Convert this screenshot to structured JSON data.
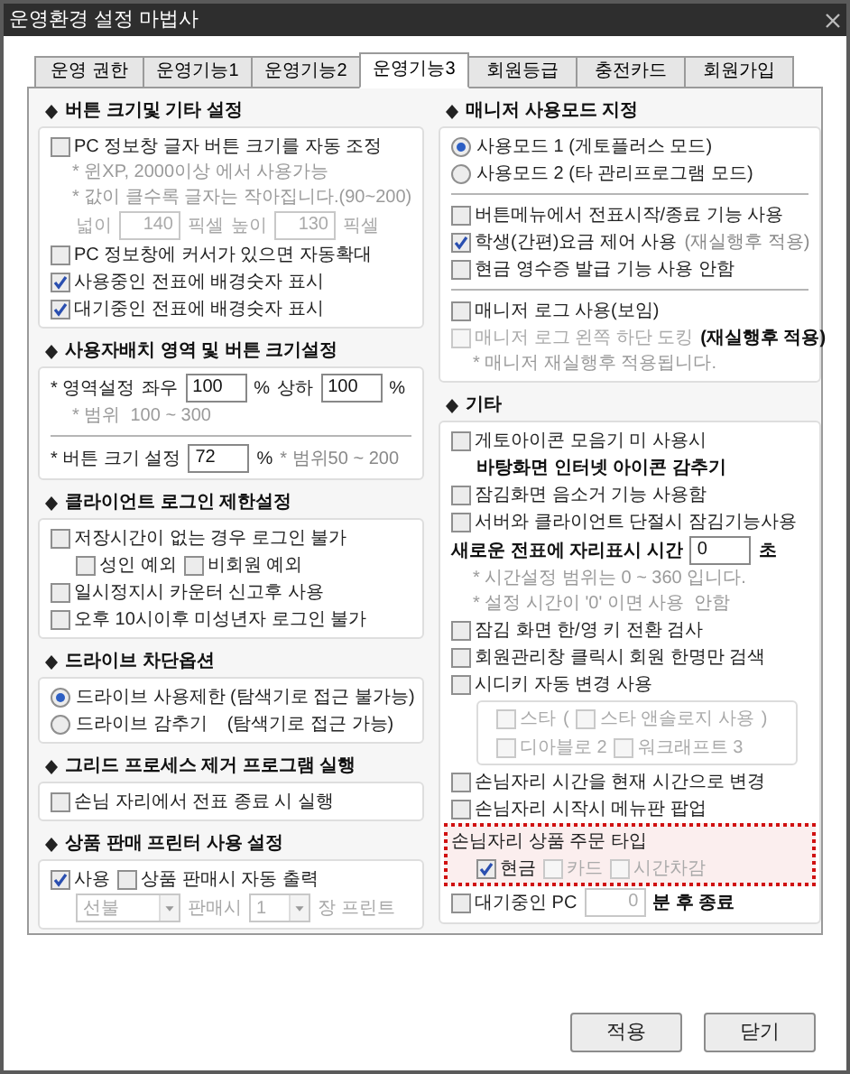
{
  "window": {
    "title": "운영환경 설정 마법사"
  },
  "tabs": [
    {
      "label": "운영 권한",
      "selected": false
    },
    {
      "label": "운영기능1",
      "selected": false
    },
    {
      "label": "운영기능2",
      "selected": false
    },
    {
      "label": "운영기능3",
      "selected": true
    },
    {
      "label": "회원등급",
      "selected": false
    },
    {
      "label": "충전카드",
      "selected": false
    },
    {
      "label": "회원가입",
      "selected": false
    }
  ],
  "left": [
    {
      "title": "버튼 크기및 기타 설정",
      "rows": [
        {
          "kind": "line",
          "parts": [
            {
              "kind": "checkbox",
              "label": "PC 정보창 글자 버튼 크기를 자동 조정",
              "checked": false,
              "disabled": false
            }
          ]
        },
        {
          "kind": "note",
          "text": "* 윈XP, 2000이상 에서 사용가능"
        },
        {
          "kind": "note",
          "text": "* 값이 클수록 글자는 작아집니다.(90~200)"
        },
        {
          "kind": "subline",
          "parts": [
            {
              "kind": "muted-text",
              "text": "넓이"
            },
            {
              "kind": "input",
              "value": "140",
              "disabled": true
            },
            {
              "kind": "muted-text",
              "text": "픽셀"
            },
            {
              "kind": "muted-text",
              "text": "높이"
            },
            {
              "kind": "input",
              "value": "130",
              "disabled": true
            },
            {
              "kind": "muted-text",
              "text": "픽셀"
            }
          ]
        },
        {
          "kind": "line",
          "parts": [
            {
              "kind": "checkbox",
              "label": "PC 정보창에 커서가 있으면 자동확대",
              "checked": false,
              "disabled": false
            }
          ]
        },
        {
          "kind": "line",
          "parts": [
            {
              "kind": "checkbox",
              "label": "사용중인 전표에 배경숫자 표시",
              "checked": true,
              "disabled": false
            }
          ]
        },
        {
          "kind": "line",
          "parts": [
            {
              "kind": "checkbox",
              "label": "대기중인 전표에 배경숫자 표시",
              "checked": true,
              "disabled": false
            }
          ]
        }
      ]
    },
    {
      "title": "사용자배치 영역 및 버튼 크기설정",
      "rows": [
        {
          "kind": "line",
          "parts": [
            {
              "kind": "text",
              "text": "* 영역설정"
            },
            {
              "kind": "text",
              "text": "좌우"
            },
            {
              "kind": "input",
              "value": "100",
              "disabled": false
            },
            {
              "kind": "text",
              "text": "%"
            },
            {
              "kind": "text",
              "text": "상하"
            },
            {
              "kind": "input",
              "value": "100",
              "disabled": false
            },
            {
              "kind": "text",
              "text": "%"
            }
          ]
        },
        {
          "kind": "note",
          "text": "* 범위  100 ~ 300"
        },
        {
          "kind": "divider"
        },
        {
          "kind": "line",
          "parts": [
            {
              "kind": "text",
              "text": "* 버튼 크기  설정"
            },
            {
              "kind": "input",
              "value": "72",
              "disabled": false
            },
            {
              "kind": "text",
              "text": "%"
            },
            {
              "kind": "hint-text",
              "text": "* 범위50 ~ 200"
            }
          ]
        }
      ]
    },
    {
      "title": "클라이언트 로그인 제한설정",
      "rows": [
        {
          "kind": "line",
          "parts": [
            {
              "kind": "checkbox",
              "label": "저장시간이 없는 경우 로그인 불가",
              "checked": false,
              "disabled": false
            }
          ]
        },
        {
          "kind": "subline",
          "parts": [
            {
              "kind": "checkbox",
              "label": "성인 예외",
              "checked": false,
              "disabled": false
            },
            {
              "kind": "checkbox",
              "label": "비회원 예외",
              "checked": false,
              "disabled": false
            }
          ]
        },
        {
          "kind": "line",
          "parts": [
            {
              "kind": "checkbox",
              "label": "일시정지시 카운터 신고후 사용",
              "checked": false,
              "disabled": false
            }
          ]
        },
        {
          "kind": "line",
          "parts": [
            {
              "kind": "checkbox",
              "label": "오후 10시이후 미성년자 로그인 불가",
              "checked": false,
              "disabled": false
            }
          ]
        }
      ]
    },
    {
      "title": "드라이브 차단옵션",
      "rows": [
        {
          "kind": "line",
          "parts": [
            {
              "kind": "radio",
              "label": "드라이브 사용제한 (탐색기로 접근 불가능)",
              "selected": true
            }
          ]
        },
        {
          "kind": "line",
          "parts": [
            {
              "kind": "radio",
              "label": "드라이브 감추기    (탐색기로 접근 가능)",
              "selected": false
            }
          ]
        }
      ]
    },
    {
      "title": "그리드 프로세스 제거 프로그램 실행",
      "rows": [
        {
          "kind": "line",
          "parts": [
            {
              "kind": "checkbox",
              "label": "손님 자리에서 전표 종료 시 실행",
              "checked": false,
              "disabled": false
            }
          ]
        }
      ]
    },
    {
      "title": "상품 판매 프린터 사용 설정",
      "rows": [
        {
          "kind": "line",
          "parts": [
            {
              "kind": "checkbox",
              "label": "사용",
              "checked": true,
              "disabled": false
            },
            {
              "kind": "checkbox",
              "label": "상품 판매시 자동 출력",
              "checked": false,
              "disabled": false
            }
          ]
        },
        {
          "kind": "subline",
          "parts": [
            {
              "kind": "select",
              "value": "선불",
              "disabled": true
            },
            {
              "kind": "muted-text",
              "text": "판매시"
            },
            {
              "kind": "select",
              "value": "1",
              "disabled": true
            },
            {
              "kind": "muted-text",
              "text": "장 프린트"
            }
          ]
        }
      ]
    }
  ],
  "right": [
    {
      "title": "매니저 사용모드 지정",
      "rows": [
        {
          "kind": "line",
          "parts": [
            {
              "kind": "radio",
              "label": "사용모드 1 (게토플러스 모드)",
              "selected": true
            }
          ]
        },
        {
          "kind": "line",
          "parts": [
            {
              "kind": "radio",
              "label": "사용모드 2 (타 관리프로그램 모드)",
              "selected": false
            }
          ]
        },
        {
          "kind": "divider"
        },
        {
          "kind": "line",
          "parts": [
            {
              "kind": "checkbox",
              "label": "버튼메뉴에서 전표시작/종료 기능 사용",
              "checked": false,
              "disabled": false
            }
          ]
        },
        {
          "kind": "line",
          "parts": [
            {
              "kind": "checkbox",
              "label": "학생(간편)요금 제어 사용",
              "checked": true,
              "disabled": false
            },
            {
              "kind": "hint-text",
              "text": "(재실행후 적용)"
            }
          ]
        },
        {
          "kind": "line",
          "parts": [
            {
              "kind": "checkbox",
              "label": "현금 영수증 발급 기능 사용 안함",
              "checked": false,
              "disabled": false
            }
          ]
        },
        {
          "kind": "divider"
        },
        {
          "kind": "line",
          "parts": [
            {
              "kind": "checkbox",
              "label": "매니저 로그 사용(보임)",
              "checked": false,
              "disabled": false
            }
          ]
        },
        {
          "kind": "line",
          "parts": [
            {
              "kind": "checkbox",
              "label": "매니저 로그 왼쪽 하단 도킹",
              "checked": false,
              "disabled": true
            },
            {
              "kind": "bold-text",
              "text": "(재실행후 적용)"
            }
          ]
        },
        {
          "kind": "note",
          "text": "* 매니저 재실행후 적용됩니다."
        }
      ]
    },
    {
      "title": "기타",
      "rows": [
        {
          "kind": "line",
          "parts": [
            {
              "kind": "checkbox",
              "label": "게토아이콘 모음기 미 사용시",
              "checked": false,
              "disabled": false
            }
          ]
        },
        {
          "kind": "subline",
          "parts": [
            {
              "kind": "bold-text",
              "text": "바탕화면 인터넷 아이콘 감추기"
            }
          ]
        },
        {
          "kind": "line",
          "parts": [
            {
              "kind": "checkbox",
              "label": "잠김화면 음소거 기능 사용함",
              "checked": false,
              "disabled": false
            }
          ]
        },
        {
          "kind": "line",
          "parts": [
            {
              "kind": "checkbox",
              "label": "서버와 클라이언트 단절시 잠김기능사용",
              "checked": false,
              "disabled": false
            }
          ]
        },
        {
          "kind": "line",
          "parts": [
            {
              "kind": "bold-text",
              "text": "새로운 전표에 자리표시 시간"
            },
            {
              "kind": "input",
              "value": "0",
              "disabled": false
            },
            {
              "kind": "bold-text",
              "text": "초"
            }
          ]
        },
        {
          "kind": "note",
          "text": "* 시간설정 범위는 0 ~ 360 입니다."
        },
        {
          "kind": "note",
          "text": "* 설정 시간이 '0' 이면 사용  안함"
        },
        {
          "kind": "line",
          "parts": [
            {
              "kind": "checkbox",
              "label": "잠김 화면 한/영 키 전환 검사",
              "checked": false,
              "disabled": false
            }
          ]
        },
        {
          "kind": "line",
          "parts": [
            {
              "kind": "checkbox",
              "label": "회원관리창 클릭시 회원 한명만 검색",
              "checked": false,
              "disabled": false
            }
          ]
        },
        {
          "kind": "line",
          "parts": [
            {
              "kind": "checkbox",
              "label": "시디키 자동 변경 사용",
              "checked": false,
              "disabled": false
            }
          ]
        },
        {
          "kind": "group",
          "rows": [
            {
              "kind": "line",
              "parts": [
                {
                  "kind": "checkbox",
                  "label": "스타",
                  "checked": false,
                  "disabled": true
                },
                {
                  "kind": "muted-text",
                  "text": "("
                },
                {
                  "kind": "checkbox",
                  "label": "스타 앤솔로지 사용",
                  "checked": false,
                  "disabled": true
                },
                {
                  "kind": "muted-text",
                  "text": ")"
                }
              ]
            },
            {
              "kind": "line",
              "parts": [
                {
                  "kind": "checkbox",
                  "label": "디아블로 2",
                  "checked": false,
                  "disabled": true
                },
                {
                  "kind": "checkbox",
                  "label": "워크래프트 3",
                  "checked": false,
                  "disabled": true
                }
              ]
            }
          ]
        },
        {
          "kind": "line",
          "parts": [
            {
              "kind": "checkbox",
              "label": "손님자리 시간을 현재 시간으로 변경",
              "checked": false,
              "disabled": false
            }
          ]
        },
        {
          "kind": "line",
          "parts": [
            {
              "kind": "checkbox",
              "label": "손님자리 시작시 메뉴판 팝업",
              "checked": false,
              "disabled": false
            }
          ]
        },
        {
          "kind": "highlight",
          "rows": [
            {
              "kind": "line",
              "parts": [
                {
                  "kind": "text",
                  "text": "손님자리 상품 주문 타입"
                }
              ]
            },
            {
              "kind": "subline",
              "parts": [
                {
                  "kind": "checkbox",
                  "label": "현금",
                  "checked": true,
                  "disabled": false
                },
                {
                  "kind": "checkbox",
                  "label": "카드",
                  "checked": false,
                  "disabled": true
                },
                {
                  "kind": "checkbox",
                  "label": "시간차감",
                  "checked": false,
                  "disabled": true
                }
              ]
            }
          ]
        },
        {
          "kind": "line",
          "parts": [
            {
              "kind": "checkbox",
              "label": "대기중인 PC",
              "checked": false,
              "disabled": false
            },
            {
              "kind": "input",
              "value": "0",
              "disabled": true
            },
            {
              "kind": "bold-text",
              "text": "분 후 종료"
            }
          ]
        }
      ]
    }
  ],
  "buttons": [
    "적용",
    "닫기"
  ]
}
